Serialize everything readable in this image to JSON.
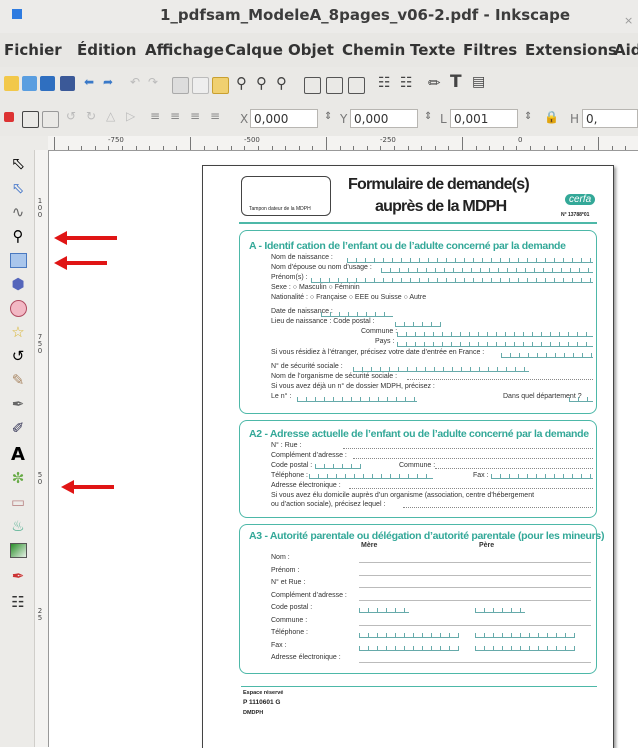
{
  "window": {
    "title": "1_pdfsam_ModeleA_8pages_v06-2.pdf - Inkscape",
    "close": "×"
  },
  "menu": [
    "Fichier",
    "Édition",
    "Affichage",
    "Calque",
    "Objet",
    "Chemin",
    "Texte",
    "Filtres",
    "Extensions",
    "Aid"
  ],
  "controls": {
    "x_label": "X",
    "x_value": "0,000",
    "y_label": "Y",
    "y_value": "0,000",
    "w_label": "L",
    "w_value": "0,001",
    "h_label": "H",
    "h_value": "0,"
  },
  "ruler": {
    "h_labels": [
      "-750",
      "-500",
      "-250",
      "0"
    ],
    "v_labels": [
      "1\n0\n0",
      "7\n5\n0",
      "5\n0",
      "2\n5"
    ]
  },
  "tools": [
    "selector-tool",
    "node-tool",
    "tweak-tool",
    "zoom-tool",
    "rectangle-tool",
    "3dbox-tool",
    "ellipse-tool",
    "star-tool",
    "spiral-tool",
    "pencil-tool",
    "pen-tool",
    "calligraphy-tool",
    "text-tool",
    "spray-tool",
    "eraser-tool",
    "paint-bucket-tool",
    "gradient-tool",
    "dropper-tool",
    "connector-tool"
  ],
  "document": {
    "stamp_label": "Tampon dateur de la MDPH",
    "title_line1": "Formulaire de demande(s)",
    "title_line2": "auprès de la MDPH",
    "cerfa": "cerfa",
    "cerfa_number": "N° 13788*01",
    "sectionA": {
      "heading": "A -   Identif cation de l’enfant ou de l’adulte concerné par la demande",
      "nom_naissance": "Nom de naissance :",
      "nom_epouse": "Nom d’épouse ou nom d’usage :",
      "prenoms": "Prénom(s) :",
      "sexe": "Sexe :    ○ Masculin    ○ Féminin",
      "nationalite": "Nationalité : ○ Française    ○ EEE ou Suisse    ○ Autre",
      "date_naissance": "Date de naissance :",
      "lieu_naissance": "Lieu de naissance :   Code postal :",
      "commune": "Commune :",
      "pays": "Pays :",
      "residez": "Si vous résidiez à l’étranger, précisez votre date d’entrée en France :",
      "secu": "N° de sécurité sociale :",
      "organisme": "Nom de l’organisme de sécurité sociale :",
      "dossier": "Si vous avez déjà un n° de dossier MDPH, précisez :",
      "le_no": "Le n° :",
      "departement": "Dans quel département ?"
    },
    "sectionA2": {
      "heading": "A2 -  Adresse actuelle de l’enfant ou de l’adulte concerné par la demande",
      "no_rue": "N° :              Rue :",
      "complement": "Complément d’adresse :",
      "code_postal": "Code postal :",
      "commune": "Commune :",
      "telephone": "Téléphone :",
      "fax": "Fax :",
      "email": "Adresse électronique :",
      "domicile1": "Si vous avez élu domicile auprès d’un organisme (association, centre d’hébergement",
      "domicile2": "ou d’action sociale), précisez lequel :"
    },
    "sectionA3": {
      "heading": "A3 -  Autorité parentale ou délégation d’autorité parentale (pour les mineurs)",
      "mere": "Mère",
      "pere": "Père",
      "rows": [
        "Nom :",
        "Prénom :",
        "N° et Rue :",
        "Complément d’adresse :",
        "Code postal :",
        "Commune :",
        "Téléphone :",
        "Fax :",
        "Adresse électronique :"
      ]
    },
    "footer": {
      "espace": "Espace réservé",
      "code": "P 1110601 G",
      "mdph": "DMDPH"
    }
  },
  "colors": {
    "accent": "#4db8a8",
    "arrow": "#e01515"
  }
}
